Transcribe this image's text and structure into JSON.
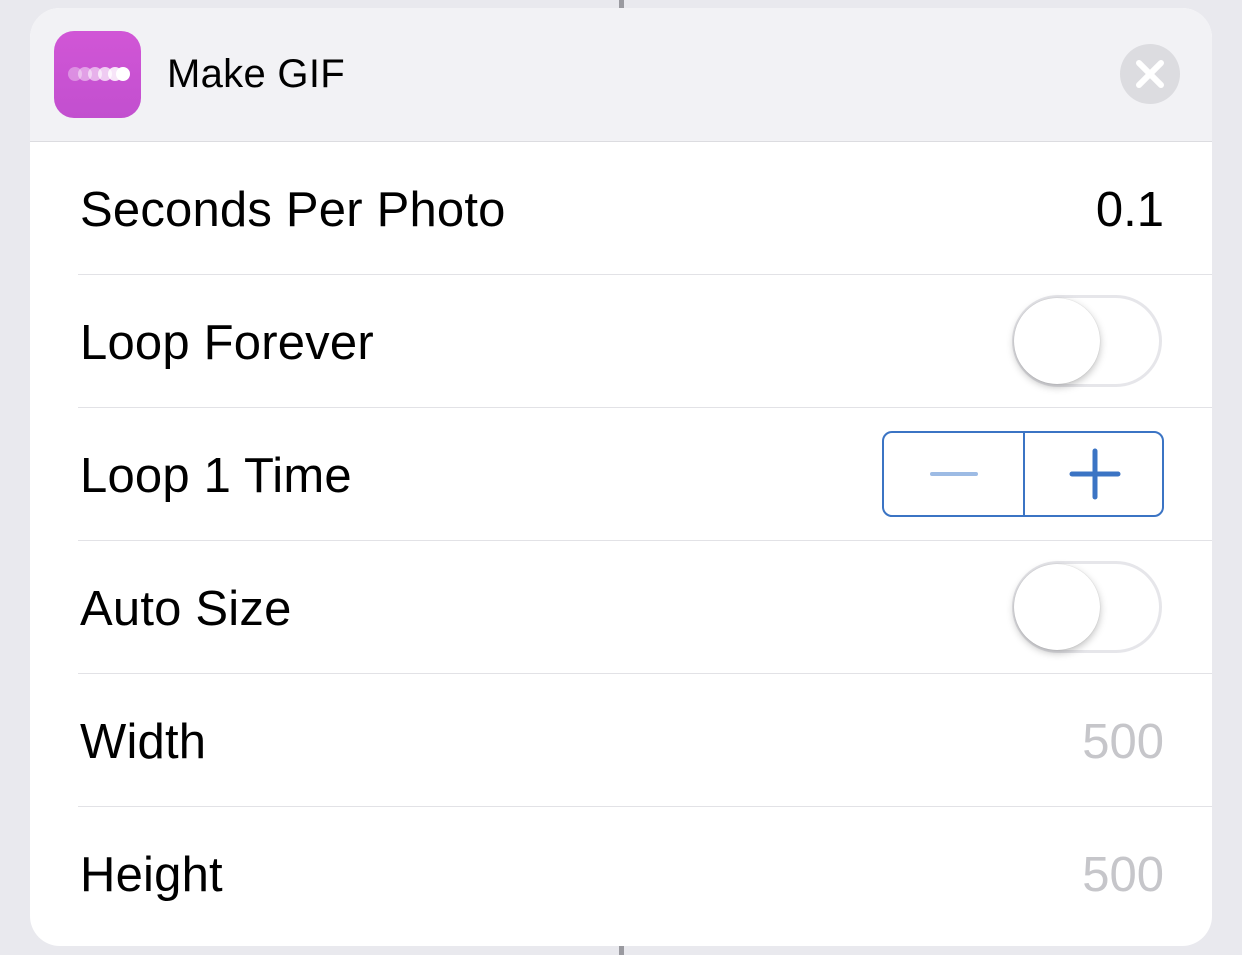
{
  "header": {
    "title": "Make GIF",
    "app_icon": "make-gif-dots-icon",
    "close_icon": "close-x-icon",
    "icon_color": "#c852d2"
  },
  "rows": [
    {
      "label": "Seconds Per Photo",
      "value": "0.1"
    },
    {
      "label": "Loop Forever",
      "toggle_on": false
    },
    {
      "label": "Loop 1 Time",
      "stepper": {
        "minus_icon": "minus-icon",
        "plus_icon": "plus-icon"
      }
    },
    {
      "label": "Auto Size",
      "toggle_on": false
    },
    {
      "label": "Width",
      "placeholder": "500"
    },
    {
      "label": "Height",
      "placeholder": "500"
    }
  ],
  "colors": {
    "accent": "#3b74c4",
    "placeholder_text": "#c6c6ca",
    "header_bg": "#f2f2f5"
  }
}
